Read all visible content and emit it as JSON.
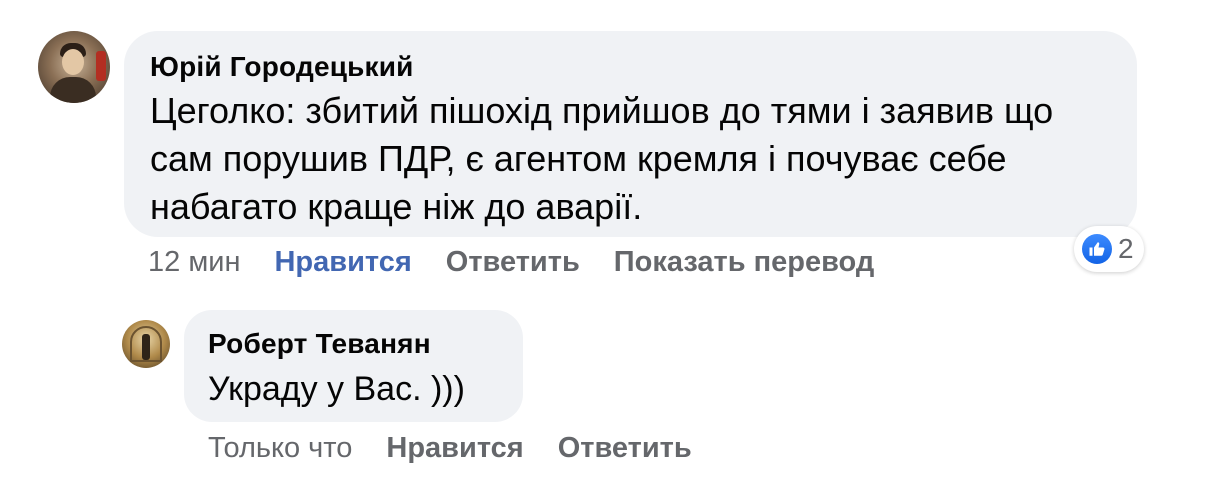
{
  "comments": [
    {
      "author": "Юрій Городецький",
      "text": "Цеголко: збитий пішохід прийшов до тями і заявив що\nсам порушив ПДР, є агентом кремля і почуває себе\nнабагато краще ніж до аварії.",
      "time": "12 мин",
      "like_label": "Нравится",
      "reply_label": "Ответить",
      "translate_label": "Показать перевод",
      "reactions": {
        "icon": "like-icon",
        "count": "2",
        "color": "#1877f2"
      },
      "liked": true
    }
  ],
  "replies": [
    {
      "author": "Роберт Теванян",
      "text": "Украду у Вас. )))",
      "time": "Только что",
      "like_label": "Нравится",
      "reply_label": "Ответить"
    }
  ],
  "colors": {
    "bubble": "#f0f2f5",
    "liked_text": "#4267b2",
    "secondary_text": "#65676b"
  }
}
